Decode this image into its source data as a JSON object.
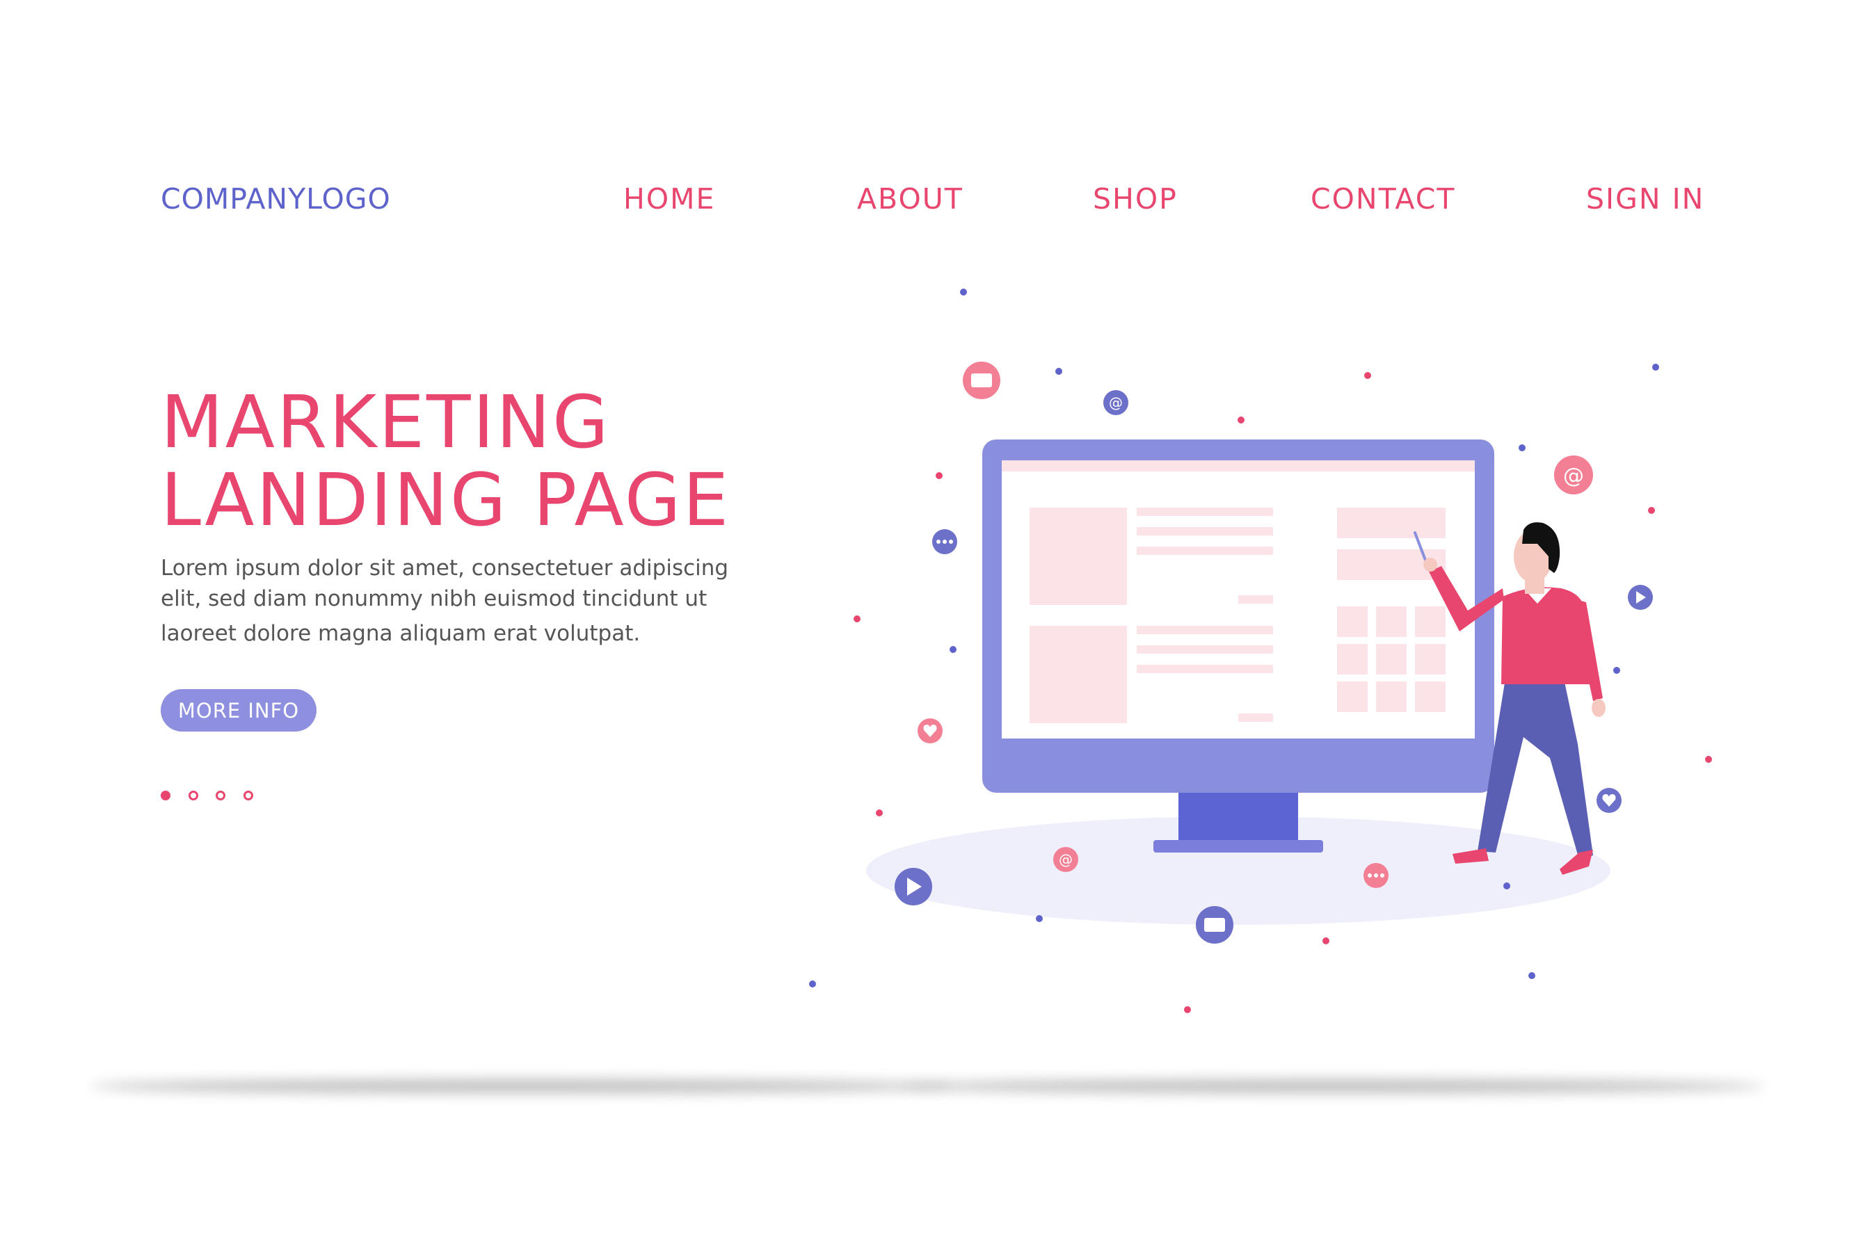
{
  "header": {
    "logo": "COMPANYLOGO",
    "nav": [
      {
        "label": "HOME"
      },
      {
        "label": "ABOUT"
      },
      {
        "label": "SHOP"
      },
      {
        "label": "CONTACT"
      },
      {
        "label": "SIGN IN"
      }
    ]
  },
  "hero": {
    "title_line1": "MARKETING",
    "title_line2": "LANDING PAGE",
    "description": [
      "Lorem ipsum dolor sit amet, consectetuer adipiscing",
      "elit, sed diam nonummy nibh euismod tincidunt ut",
      "laoreet dolore magna aliquam erat volutpat."
    ],
    "button_label": "MORE INFO",
    "carousel": {
      "total": 4,
      "active": 1
    }
  },
  "illustration": {
    "floating_icons": [
      "chat-bubble-icon",
      "at-sign-icon",
      "more-dots-icon",
      "heart-icon",
      "play-icon"
    ]
  },
  "colors": {
    "accent_pink": "#e8466f",
    "accent_purple": "#5e63cc",
    "button_purple": "#8e8fde",
    "monitor_purple": "#8a8fdd",
    "monitor_stand": "#5c63d2",
    "screen_block_pink": "#fce3e7",
    "floor_shadow": "#efeffb"
  }
}
